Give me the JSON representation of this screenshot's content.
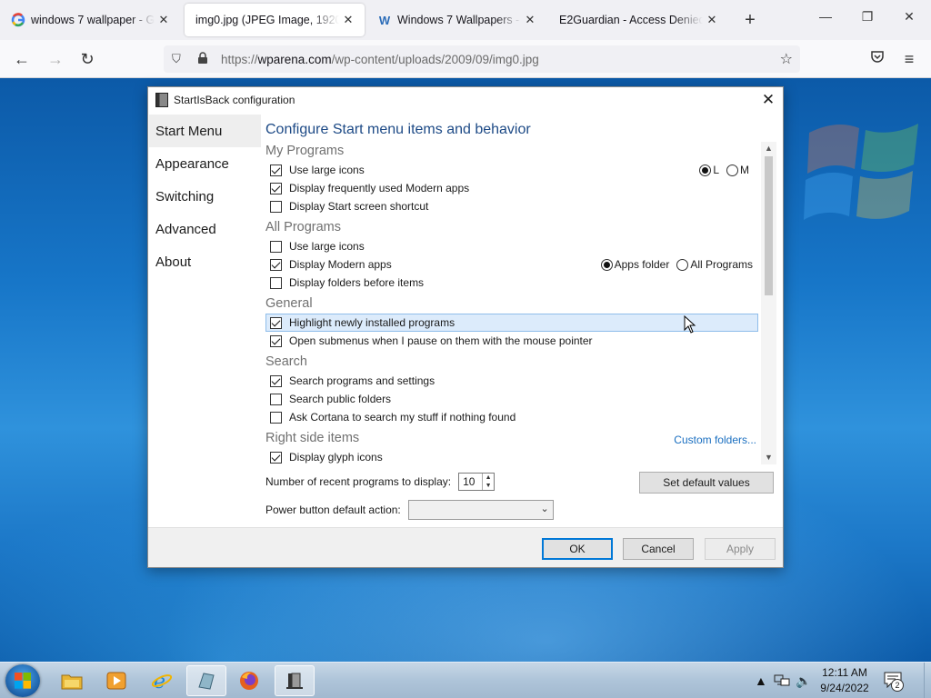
{
  "browser": {
    "tabs": [
      {
        "title": "windows 7 wallpaper - Goo",
        "favicon": "google-icon"
      },
      {
        "title": "img0.jpg (JPEG Image, 1920 × 1200",
        "favicon": "none",
        "active": true
      },
      {
        "title": "Windows 7 Wallpapers - To",
        "favicon": "wp-icon"
      },
      {
        "title": "E2Guardian - Access Denied",
        "favicon": "none"
      }
    ],
    "url_prefix": "https://",
    "url_domain": "wparena.com",
    "url_path": "/wp-content/uploads/2009/09/img0.jpg"
  },
  "dialog": {
    "title": "StartIsBack configuration",
    "sidebar": [
      "Start Menu",
      "Appearance",
      "Switching",
      "Advanced",
      "About"
    ],
    "heading": "Configure Start menu items and behavior",
    "sections": {
      "my_programs": {
        "label": "My Programs",
        "items": [
          {
            "label": "Use large icons",
            "checked": true
          },
          {
            "label": "Display frequently used Modern apps",
            "checked": true
          },
          {
            "label": "Display Start screen shortcut",
            "checked": false
          }
        ],
        "radio_l": "L",
        "radio_m": "M",
        "selected": "L"
      },
      "all_programs": {
        "label": "All Programs",
        "items": [
          {
            "label": "Use large icons",
            "checked": false
          },
          {
            "label": "Display Modern apps",
            "checked": true
          },
          {
            "label": "Display folders before items",
            "checked": false
          }
        ],
        "radio_apps": "Apps folder",
        "radio_all": "All Programs",
        "selected": "Apps folder"
      },
      "general": {
        "label": "General",
        "items": [
          {
            "label": "Highlight newly installed programs",
            "checked": true
          },
          {
            "label": "Open submenus when I pause on them with the mouse pointer",
            "checked": true
          }
        ]
      },
      "search": {
        "label": "Search",
        "items": [
          {
            "label": "Search programs and settings",
            "checked": true
          },
          {
            "label": "Search public folders",
            "checked": false
          },
          {
            "label": "Ask Cortana to search my stuff if nothing found",
            "checked": false
          }
        ]
      },
      "right_side": {
        "label": "Right side items",
        "link": "Custom folders...",
        "items": [
          {
            "label": "Display glyph icons",
            "checked": true
          }
        ]
      }
    },
    "recent_label": "Number of recent programs to display:",
    "recent_value": "10",
    "default_button": "Set default values",
    "power_label": "Power button default action:",
    "power_value": "",
    "ok": "OK",
    "cancel": "Cancel",
    "apply": "Apply"
  },
  "taskbar": {
    "time": "12:11 AM",
    "date": "9/24/2022",
    "notifications": "2"
  },
  "colors": {
    "accent": "#0078d7",
    "heading": "#1d4a86",
    "link": "#1a6fc0",
    "highlight": "#dcebfb"
  }
}
